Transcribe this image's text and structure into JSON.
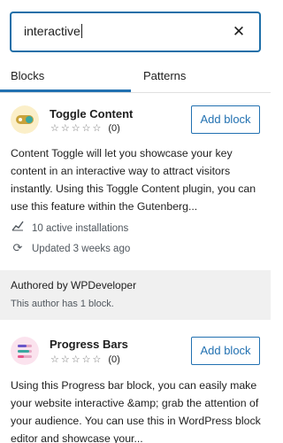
{
  "search": {
    "value": "interactive",
    "clear_symbol": "✕"
  },
  "tabs": [
    {
      "label": "Blocks"
    },
    {
      "label": "Patterns"
    }
  ],
  "plugins": [
    {
      "title": "Toggle Content",
      "rating_count": "(0)",
      "stars": "☆☆☆☆☆",
      "add_label": "Add block",
      "description": "Content Toggle will let you showcase your key content in an interactive way to attract visitors instantly. Using this Toggle Content plugin, you can use this feature within the Gutenberg...",
      "installs": "10 active installations",
      "updated": "Updated 3 weeks ago"
    },
    {
      "title": "Progress Bars",
      "rating_count": "(0)",
      "stars": "☆☆☆☆☆",
      "add_label": "Add block",
      "description": "Using this Progress bar block, you can easily make your website interactive &amp; grab the attention of your audience. You can use this in WordPress block editor and showcase your..."
    }
  ],
  "author": {
    "title": "Authored by WPDeveloper",
    "subtitle": "This author has 1 block."
  },
  "colors": {
    "accent": "#2271b1"
  }
}
